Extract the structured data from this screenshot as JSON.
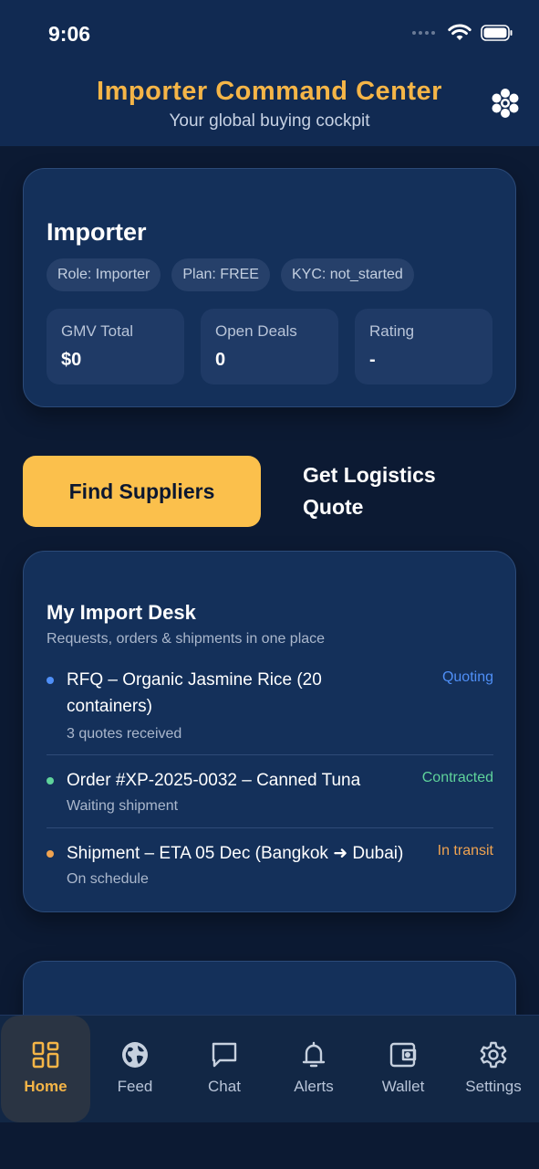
{
  "status_bar": {
    "time": "9:06"
  },
  "header": {
    "title": "Importer Command Center",
    "subtitle": "Your global buying cockpit"
  },
  "profile": {
    "name": "Importer",
    "chips": [
      "Role: Importer",
      "Plan: FREE",
      "KYC: not_started"
    ],
    "stats": [
      {
        "label": "GMV Total",
        "value": "$0"
      },
      {
        "label": "Open Deals",
        "value": "0"
      },
      {
        "label": "Rating",
        "value": "-"
      }
    ]
  },
  "actions": {
    "primary_label": "Find Suppliers",
    "secondary_label": "Get Logistics Quote"
  },
  "desk": {
    "title": "My Import Desk",
    "subtitle": "Requests, orders & shipments in one place",
    "items": [
      {
        "title": "RFQ – Organic Jasmine Rice (20 containers)",
        "meta": "3 quotes received",
        "status": "Quoting",
        "status_color": "#4f8ff7"
      },
      {
        "title": "Order #XP-2025-0032 – Canned Tuna",
        "meta": "Waiting shipment",
        "status": "Contracted",
        "status_color": "#5fd39b"
      },
      {
        "title": "Shipment – ETA 05 Dec (Bangkok ➜ Dubai)",
        "meta": "On schedule",
        "status": "In transit",
        "status_color": "#f0a350"
      }
    ]
  },
  "nav": {
    "items": [
      {
        "label": "Home",
        "icon": "home-grid-icon",
        "active": true
      },
      {
        "label": "Feed",
        "icon": "globe-icon",
        "active": false
      },
      {
        "label": "Chat",
        "icon": "chat-icon",
        "active": false
      },
      {
        "label": "Alerts",
        "icon": "bell-icon",
        "active": false
      },
      {
        "label": "Wallet",
        "icon": "wallet-icon",
        "active": false
      },
      {
        "label": "Settings",
        "icon": "gear-icon",
        "active": false
      }
    ]
  },
  "colors": {
    "accent": "#f5b547",
    "primary_button": "#fbc04c",
    "background": "#0c1a33",
    "card": "#14305a"
  }
}
